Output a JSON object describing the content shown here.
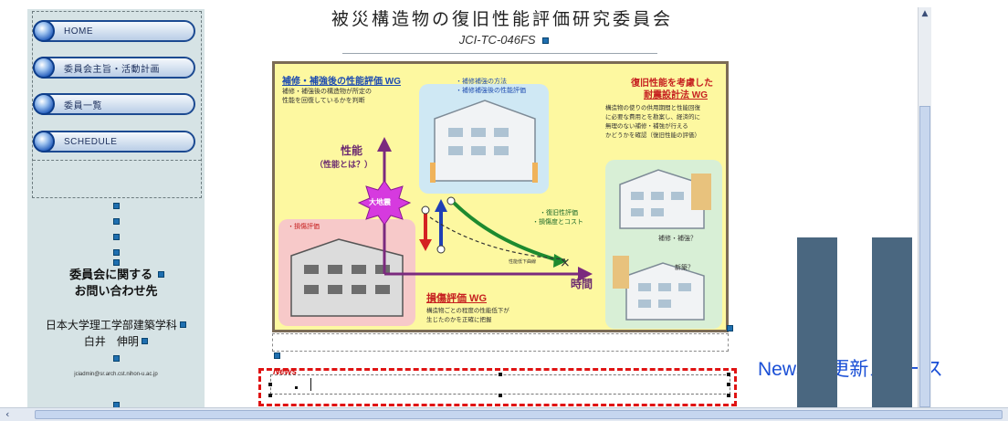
{
  "sidebar": {
    "nav": [
      {
        "label": "HOME"
      },
      {
        "label": "委員会主旨・活動計画"
      },
      {
        "label": "委員一覧"
      },
      {
        "label": "SCHEDULE"
      }
    ],
    "contact_title_line1": "委員会に関する",
    "contact_title_line2": "お問い合わせ先",
    "affiliation": "日本大学理工学部建築学科",
    "person": "白井　伸明",
    "email": "jciadmin@sr.arch.cst.nihon-u.ac.jp"
  },
  "header": {
    "title": "被災構造物の復旧性能評価研究委員会",
    "subtitle": "JCI-TC-046FS"
  },
  "figure": {
    "wg1_title": "補修・補強後の性能評価 WG",
    "wg1_desc_1": "補修・補強後の構造物が所定の",
    "wg1_desc_2": "性能を回復しているかを判断",
    "wg1_bullet_1": "・補修補強の方法",
    "wg1_bullet_2": "・補修補強後の性能評価",
    "wg2_title_1": "復旧性能を考慮した",
    "wg2_title_2": "耐震設計法 WG",
    "wg2_desc_1": "構造物の使りの供用期間と性能回復",
    "wg2_desc_2": "に必要な費用とを勘案し、経済的に",
    "wg2_desc_3": "無理のない補修・補強が行える",
    "wg2_desc_4": "かどうかを確認（復旧性能の評価）",
    "performance_label": "性能",
    "performance_sub": "（性能とは？）",
    "earthquake_label": "大地震",
    "damage_eval_bullet": "・損傷評価",
    "recovery_bullet_1": "・復旧性評価",
    "recovery_bullet_2": "・損傷度とコスト",
    "perf_degradation": "性能低下曲線",
    "time_label": "時間",
    "wg3_title": "損傷評価 WG",
    "wg3_desc_1": "構造物ごとの程度の性能低下が",
    "wg3_desc_2": "生じたのかを正確に把握",
    "repair_question": "補修・補強？",
    "rebuild_question": "新築？"
  },
  "news": {
    "label": "News"
  },
  "callout": {
    "text": "News の更新スペース"
  },
  "colors": {
    "figure_bg": "#fdf8a0",
    "sidebar_bg": "#d6e3e5",
    "callout": "#1a4fd6",
    "dashed_red": "#e01313",
    "deco_block": "#4a6780"
  },
  "icons": {
    "scroll_up": "chevron-up-icon",
    "scroll_left": "chevron-left-icon"
  }
}
